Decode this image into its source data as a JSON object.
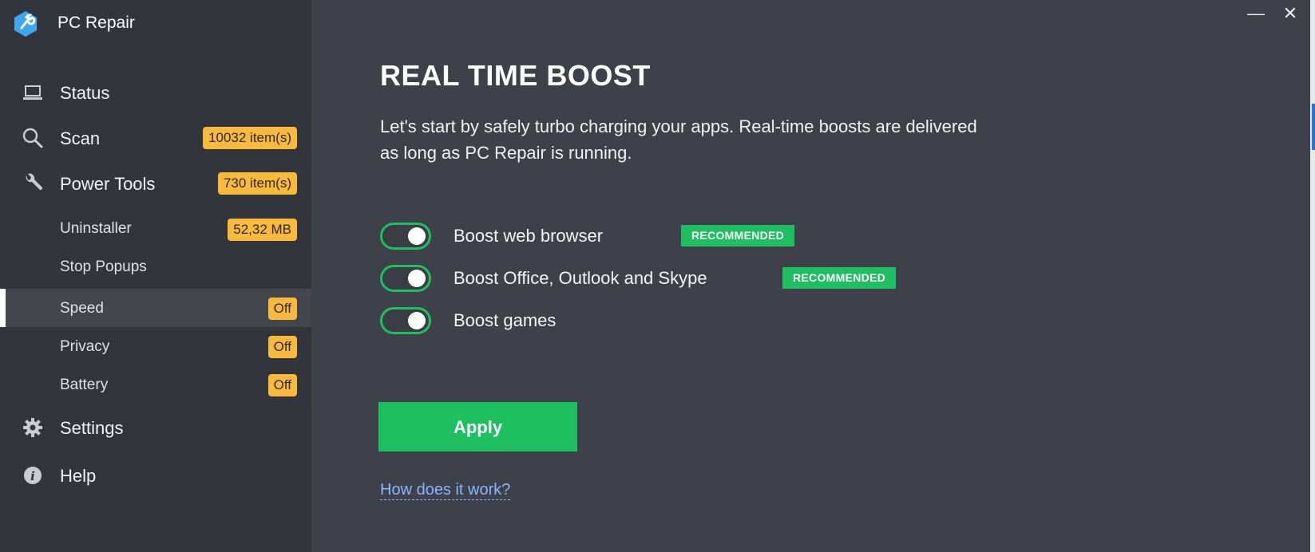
{
  "app": {
    "title": "PC Repair"
  },
  "window_controls": {
    "minimize": "—",
    "close": "✕"
  },
  "sidebar": {
    "status": {
      "label": "Status"
    },
    "scan": {
      "label": "Scan",
      "badge": "10032 item(s)"
    },
    "power_tools": {
      "label": "Power Tools",
      "badge": "730 item(s)"
    },
    "uninstaller": {
      "label": "Uninstaller",
      "badge": "52,32 MB"
    },
    "stop_popups": {
      "label": "Stop Popups"
    },
    "speed": {
      "label": "Speed",
      "badge": "Off",
      "active": true
    },
    "privacy": {
      "label": "Privacy",
      "badge": "Off"
    },
    "battery": {
      "label": "Battery",
      "badge": "Off"
    },
    "settings": {
      "label": "Settings"
    },
    "help": {
      "label": "Help"
    }
  },
  "main": {
    "title": "REAL TIME BOOST",
    "description": "Let's start by safely turbo charging your apps. Real-time boosts are delivered as long as PC Repair is running.",
    "options": [
      {
        "label": "Boost web browser",
        "badge": "RECOMMENDED",
        "enabled": true
      },
      {
        "label": "Boost Office, Outlook and Skype",
        "badge": "RECOMMENDED",
        "enabled": true
      },
      {
        "label": "Boost games",
        "enabled": true
      }
    ],
    "apply_label": "Apply",
    "help_link": "How does it work?"
  },
  "colors": {
    "accent_green": "#1dbf60",
    "badge_yellow": "#f9b93a",
    "sidebar_bg": "#33353d",
    "main_bg": "#3f414a",
    "link_blue": "#86b5ff"
  }
}
